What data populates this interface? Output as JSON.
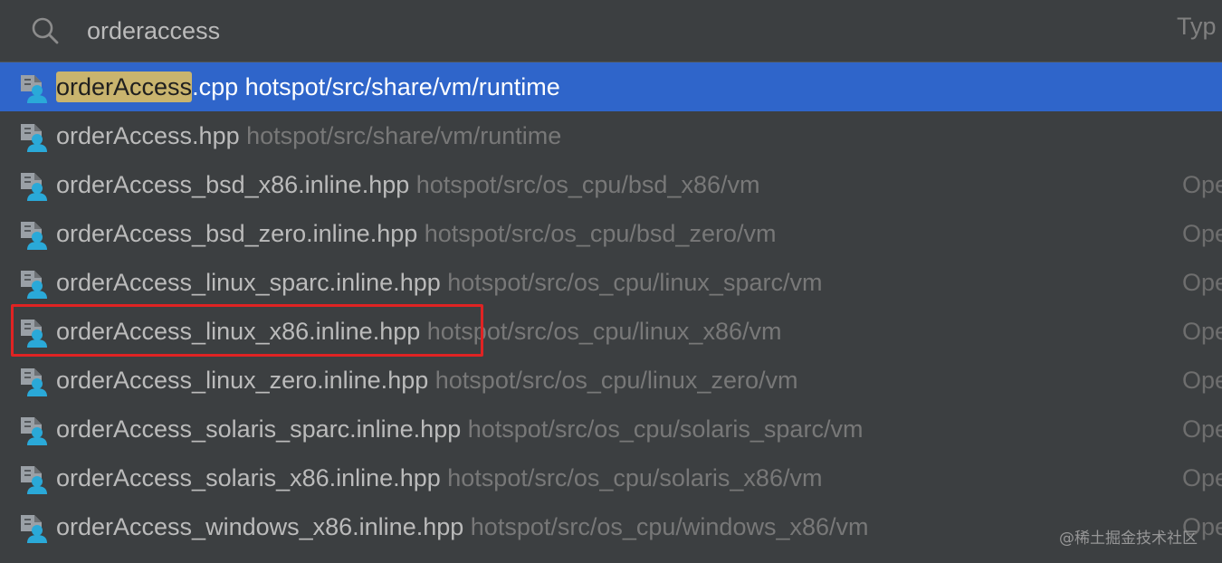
{
  "search": {
    "value": "orderaccess",
    "type_column_header": "Typ"
  },
  "results": [
    {
      "match": "orderAccess",
      "rest": ".cpp",
      "path": "hotspot/src/share/vm/runtime",
      "module": "",
      "selected": true,
      "icon": "cpp-file-icon"
    },
    {
      "match": "",
      "rest": "orderAccess.hpp",
      "path": "hotspot/src/share/vm/runtime",
      "module": "",
      "selected": false,
      "icon": "header-file-icon"
    },
    {
      "match": "",
      "rest": "orderAccess_bsd_x86.inline.hpp",
      "path": "hotspot/src/os_cpu/bsd_x86/vm",
      "module": "Ope",
      "selected": false,
      "icon": "header-file-icon"
    },
    {
      "match": "",
      "rest": "orderAccess_bsd_zero.inline.hpp",
      "path": "hotspot/src/os_cpu/bsd_zero/vm",
      "module": "Ope",
      "selected": false,
      "icon": "header-file-icon"
    },
    {
      "match": "",
      "rest": "orderAccess_linux_sparc.inline.hpp",
      "path": "hotspot/src/os_cpu/linux_sparc/vm",
      "module": "Ope",
      "selected": false,
      "icon": "header-file-icon"
    },
    {
      "match": "",
      "rest": "orderAccess_linux_x86.inline.hpp",
      "path": "hotspot/src/os_cpu/linux_x86/vm",
      "module": "Ope",
      "selected": false,
      "icon": "header-file-icon"
    },
    {
      "match": "",
      "rest": "orderAccess_linux_zero.inline.hpp",
      "path": "hotspot/src/os_cpu/linux_zero/vm",
      "module": "Ope",
      "selected": false,
      "icon": "header-file-icon"
    },
    {
      "match": "",
      "rest": "orderAccess_solaris_sparc.inline.hpp",
      "path": "hotspot/src/os_cpu/solaris_sparc/vm",
      "module": "Ope",
      "selected": false,
      "icon": "header-file-icon"
    },
    {
      "match": "",
      "rest": "orderAccess_solaris_x86.inline.hpp",
      "path": "hotspot/src/os_cpu/solaris_x86/vm",
      "module": "Ope",
      "selected": false,
      "icon": "header-file-icon"
    },
    {
      "match": "",
      "rest": "orderAccess_windows_x86.inline.hpp",
      "path": "hotspot/src/os_cpu/windows_x86/vm",
      "module": "Ope",
      "selected": false,
      "icon": "header-file-icon"
    }
  ],
  "watermark": "@稀土掘金技术社区",
  "colors": {
    "background": "#3c3f41",
    "selection": "#2f65ca",
    "match_highlight": "#c9b46e",
    "annotation_box": "#e02323",
    "icon_gray": "#9aa0a6",
    "icon_cyan": "#2aa9d8"
  }
}
